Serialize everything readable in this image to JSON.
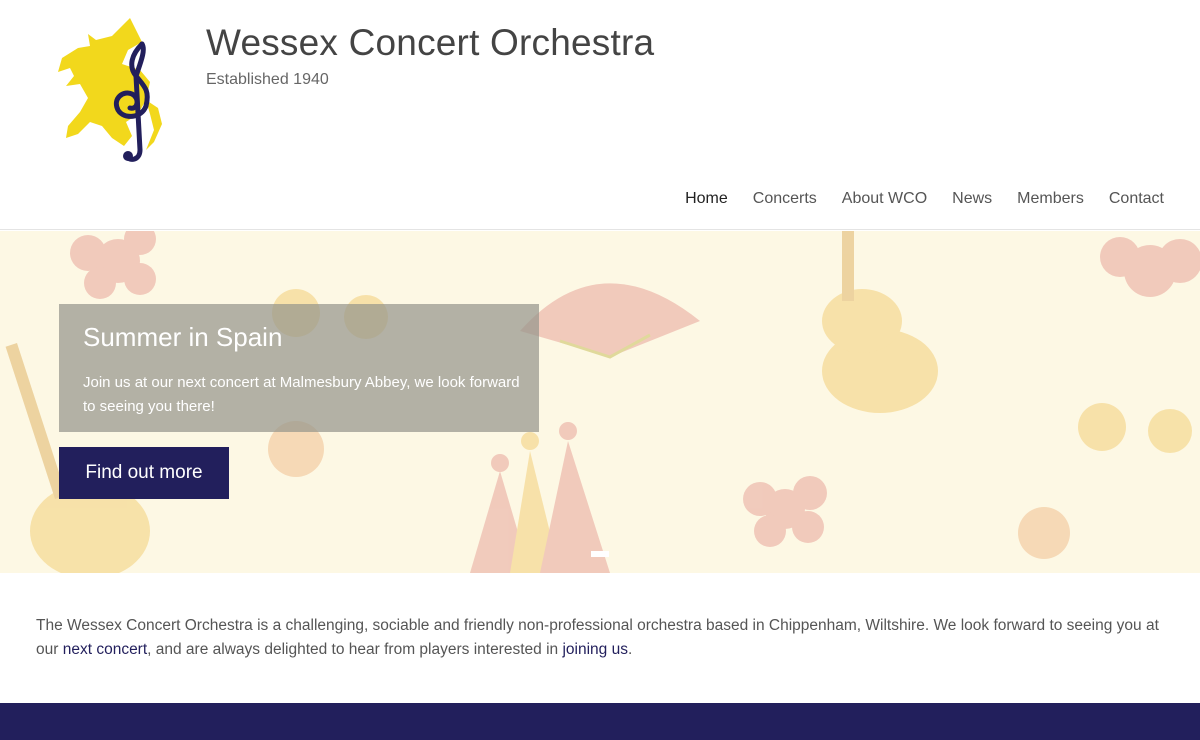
{
  "header": {
    "title": "Wessex Concert Orchestra",
    "tagline": "Established 1940",
    "logo_icon": "dragon-treble-clef-icon"
  },
  "nav": {
    "items": [
      {
        "label": "Home",
        "active": true
      },
      {
        "label": "Concerts"
      },
      {
        "label": "About WCO"
      },
      {
        "label": "News"
      },
      {
        "label": "Members"
      },
      {
        "label": "Contact"
      }
    ]
  },
  "hero": {
    "title": "Summer in Spain",
    "text": "Join us at our next concert at Malmesbury Abbey, we look forward to seeing you there!",
    "button_label": "Find out more"
  },
  "intro": {
    "text_1": "The Wessex Concert Orchestra is a challenging, sociable and friendly non-professional orchestra based in Chippenham, Wiltshire. We look forward to seeing you at our ",
    "link_1": "next concert",
    "text_2": ", and are always delighted to hear from players interested in ",
    "link_2": "joining us",
    "text_3": "."
  },
  "colors": {
    "brand_navy": "#221f5c",
    "logo_yellow": "#f2d81c",
    "hero_bg": "#fdf8e4"
  }
}
